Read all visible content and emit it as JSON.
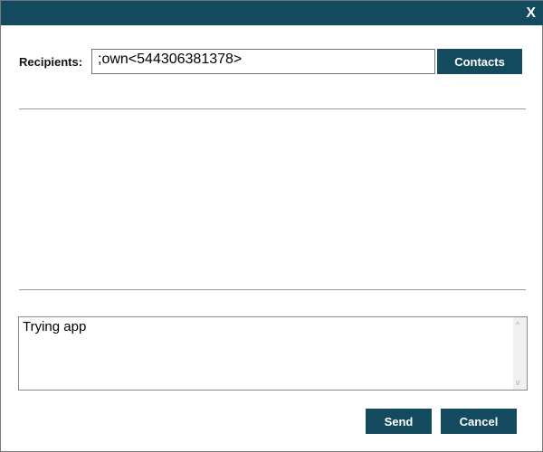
{
  "window": {
    "close_label": "X"
  },
  "recipients": {
    "label": "Recipients:",
    "value": ";own<544306381378>",
    "contacts_label": "Contacts"
  },
  "message": {
    "value": "Trying app"
  },
  "actions": {
    "send_label": "Send",
    "cancel_label": "Cancel"
  },
  "colors": {
    "accent": "#134a5e"
  }
}
